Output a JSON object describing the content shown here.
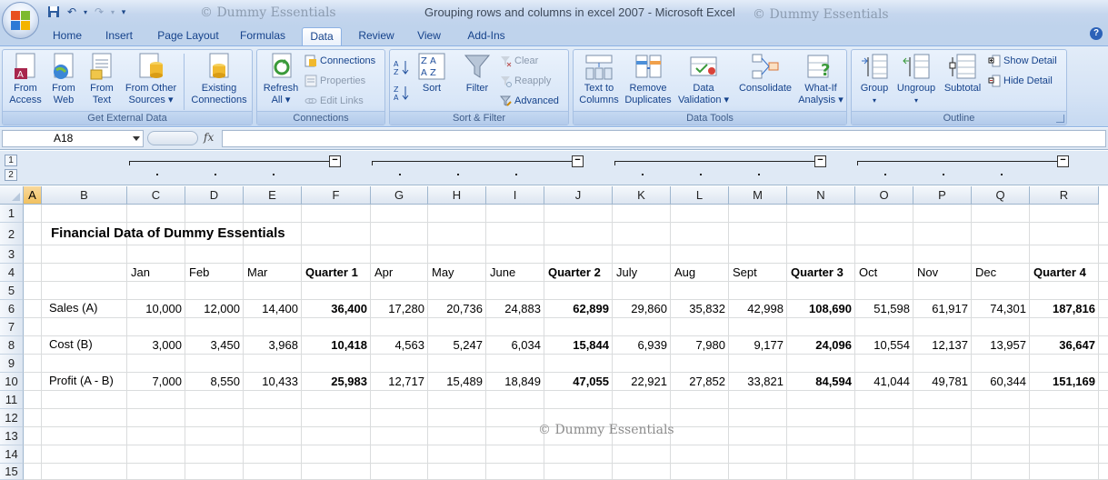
{
  "window": {
    "title": "Grouping rows and columns in excel 2007  -  Microsoft Excel",
    "watermark": "© Dummy Essentials"
  },
  "ribbon_tabs": [
    "Home",
    "Insert",
    "Page Layout",
    "Formulas",
    "Data",
    "Review",
    "View",
    "Add-Ins"
  ],
  "active_tab": "Data",
  "groups": {
    "get_external_data": {
      "label": "Get External Data",
      "from_access": [
        "From",
        "Access"
      ],
      "from_web": [
        "From",
        "Web"
      ],
      "from_text": [
        "From",
        "Text"
      ],
      "from_other": [
        "From Other",
        "Sources ▾"
      ],
      "existing": [
        "Existing",
        "Connections"
      ]
    },
    "connections": {
      "label": "Connections",
      "refresh": [
        "Refresh",
        "All ▾"
      ],
      "connections": "Connections",
      "properties": "Properties",
      "edit_links": "Edit Links"
    },
    "sort_filter": {
      "label": "Sort & Filter",
      "sort": "Sort",
      "filter": "Filter",
      "clear": "Clear",
      "reapply": "Reapply",
      "advanced": "Advanced"
    },
    "data_tools": {
      "label": "Data Tools",
      "text_to_columns": [
        "Text to",
        "Columns"
      ],
      "remove_duplicates": [
        "Remove",
        "Duplicates"
      ],
      "data_validation": [
        "Data",
        "Validation ▾"
      ],
      "consolidate": "Consolidate",
      "what_if": [
        "What-If",
        "Analysis ▾"
      ]
    },
    "outline": {
      "label": "Outline",
      "group": [
        "Group",
        "▾"
      ],
      "ungroup": [
        "Ungroup",
        "▾"
      ],
      "subtotal": "Subtotal",
      "show_detail": "Show Detail",
      "hide_detail": "Hide Detail"
    }
  },
  "formula_bar": {
    "name_box": "A18",
    "fx": "fx",
    "formula": ""
  },
  "outline_levels": [
    "1",
    "2"
  ],
  "outline_collapse_symbol": "−",
  "columns": [
    "A",
    "B",
    "C",
    "D",
    "E",
    "F",
    "G",
    "H",
    "I",
    "J",
    "K",
    "L",
    "M",
    "N",
    "O",
    "P",
    "Q",
    "R"
  ],
  "rows": [
    "1",
    "2",
    "3",
    "4",
    "5",
    "6",
    "7",
    "8",
    "9",
    "10",
    "11",
    "12",
    "13",
    "14",
    "15"
  ],
  "sheet": {
    "title": "Financial Data of Dummy Essentials",
    "headers": [
      "Jan",
      "Feb",
      "Mar",
      "Quarter 1",
      "Apr",
      "May",
      "June",
      "Quarter 2",
      "July",
      "Aug",
      "Sept",
      "Quarter 3",
      "Oct",
      "Nov",
      "Dec",
      "Quarter 4"
    ],
    "sales_label": "Sales (A)",
    "sales": [
      "10,000",
      "12,000",
      "14,400",
      "36,400",
      "17,280",
      "20,736",
      "24,883",
      "62,899",
      "29,860",
      "35,832",
      "42,998",
      "108,690",
      "51,598",
      "61,917",
      "74,301",
      "187,816"
    ],
    "cost_label": "Cost (B)",
    "cost": [
      "3,000",
      "3,450",
      "3,968",
      "10,418",
      "4,563",
      "5,247",
      "6,034",
      "15,844",
      "6,939",
      "7,980",
      "9,177",
      "24,096",
      "10,554",
      "12,137",
      "13,957",
      "36,647"
    ],
    "profit_label": "Profit (A - B)",
    "profit": [
      "7,000",
      "8,550",
      "10,433",
      "25,983",
      "12,717",
      "15,489",
      "18,849",
      "47,055",
      "22,921",
      "27,852",
      "33,821",
      "84,594",
      "41,044",
      "49,781",
      "60,344",
      "151,169"
    ]
  }
}
